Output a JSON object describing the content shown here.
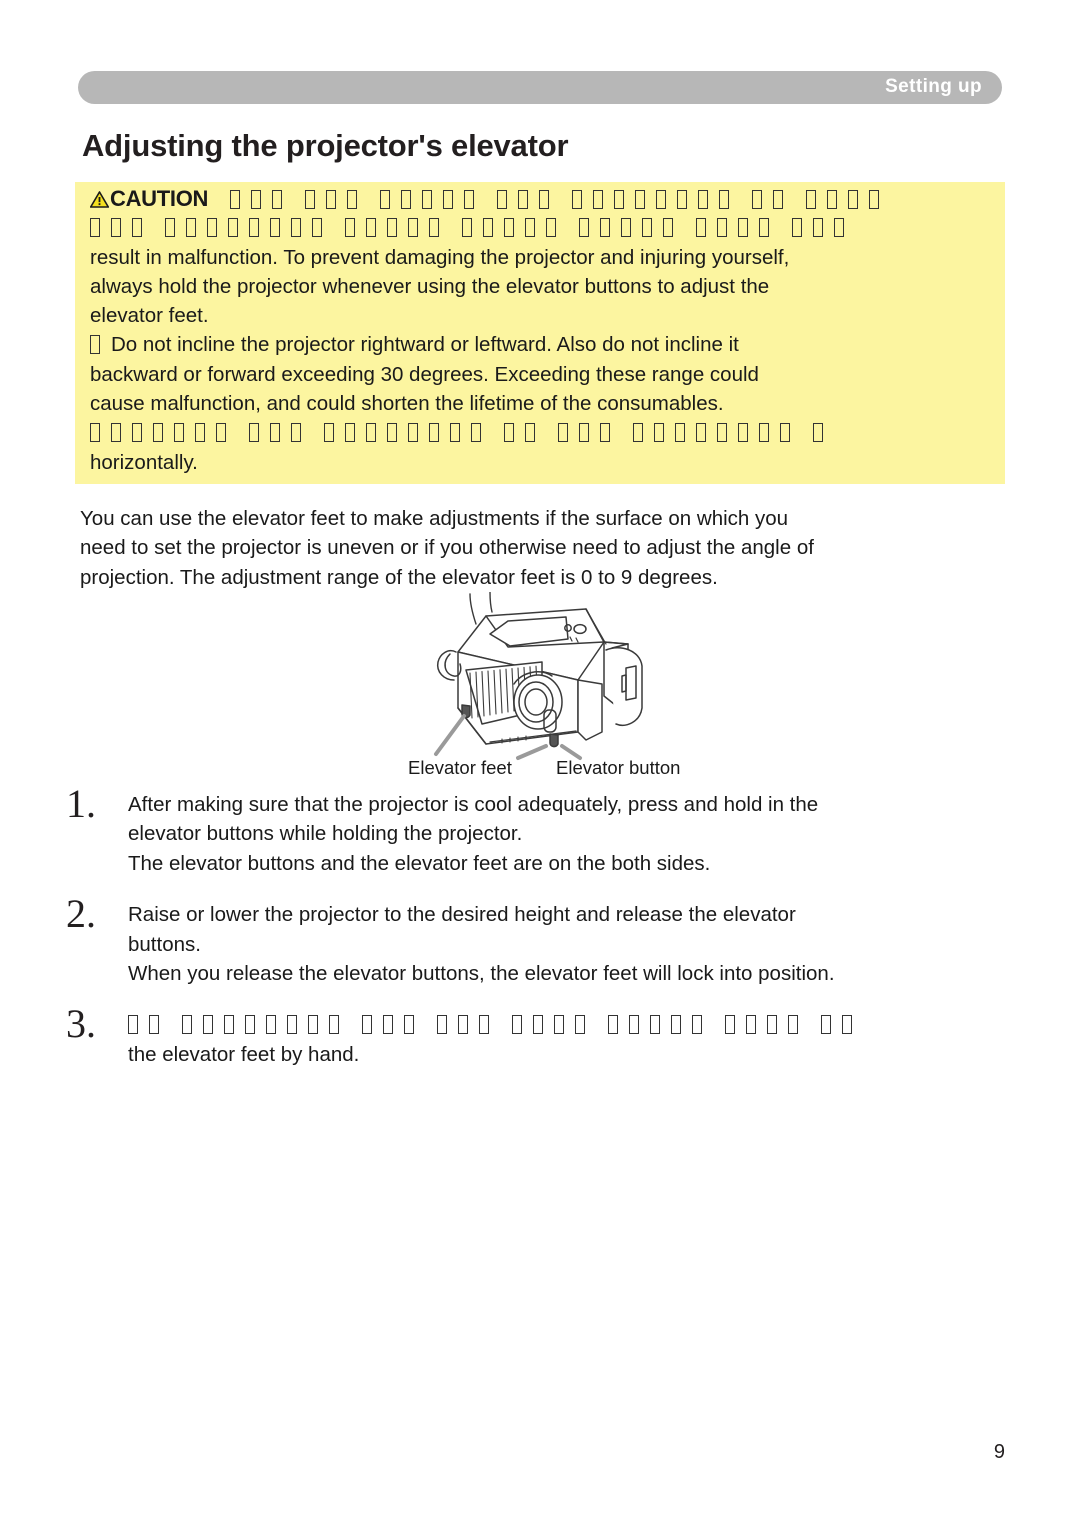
{
  "header": {
    "section_label": "Setting up"
  },
  "page_title": "Adjusting the projector's elevator",
  "caution": {
    "heading": "CAUTION",
    "warning_icon": "warning-triangle-icon",
    "background_color": "#fcf5a0",
    "lines": [
      {
        "type": "mixed",
        "heading": true,
        "tofu_groups": [
          3,
          3,
          5,
          3,
          8,
          2
        ],
        "tofu_overflow": [
          1,
          1,
          1,
          1
        ]
      },
      {
        "type": "tofu",
        "tofu_groups": [
          3,
          8,
          5,
          5,
          5,
          4
        ],
        "tofu_overflow": [
          1,
          1,
          1
        ]
      },
      {
        "type": "text",
        "text": "result in malfunction. To prevent damaging the projector and injuring yourself,"
      },
      {
        "type": "text",
        "text": "always hold the projector whenever using the elevator buttons to adjust the"
      },
      {
        "type": "text",
        "text": "elevator feet."
      },
      {
        "type": "bullet",
        "text": "Do not incline the projector rightward or leftward. Also do not incline it"
      },
      {
        "type": "text",
        "text": "backward or forward exceeding 30 degrees. Exceeding these range could"
      },
      {
        "type": "text",
        "text": "cause malfunction, and could shorten the lifetime of the consumables."
      },
      {
        "type": "tofu",
        "tofu_groups": [
          7,
          3,
          8,
          2,
          3,
          8
        ],
        "tofu_overflow": [
          1
        ]
      },
      {
        "type": "text",
        "text": "horizontally."
      }
    ]
  },
  "intro": {
    "lines": [
      "You can use the elevator feet to make adjustments if the surface on which you",
      "need to set the projector is uneven or if you otherwise need to adjust the angle of",
      "projection. The adjustment range of the elevator feet is 0 to 9 degrees."
    ]
  },
  "figure": {
    "name": "projector-illustration",
    "label_feet": "Elevator feet",
    "label_button": "Elevator button"
  },
  "steps": [
    {
      "number": "1.",
      "lines": [
        "After making sure that the projector is cool adequately, press and hold in the",
        "elevator buttons while holding the projector.",
        "The elevator buttons and the elevator feet are on the both sides."
      ],
      "tofu_groups": null
    },
    {
      "number": "2.",
      "lines": [
        "Raise or lower the projector to the desired height and release the elevator",
        "buttons.",
        "When you release the elevator buttons, the elevator feet will lock into position."
      ],
      "tofu_groups": null
    },
    {
      "number": "3.",
      "lines": [
        "the elevator feet by hand."
      ],
      "tofu_groups": [
        2,
        8,
        3,
        3,
        4,
        5,
        4
      ],
      "tofu_overflow": [
        1,
        1
      ]
    }
  ],
  "page_number": "9"
}
